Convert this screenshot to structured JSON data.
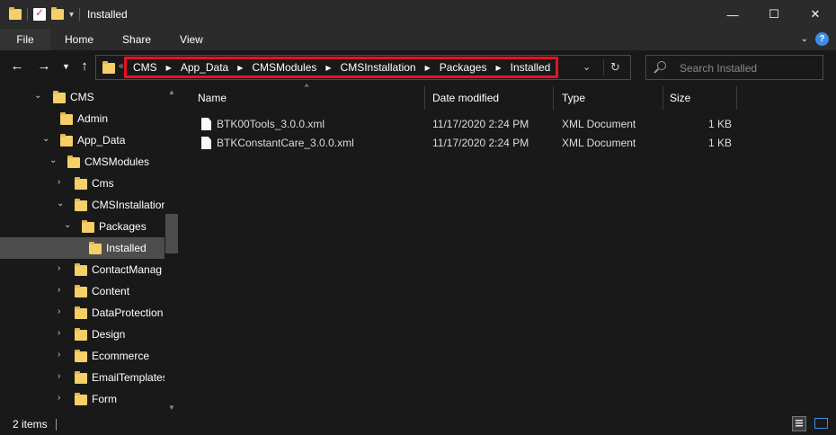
{
  "window": {
    "title": "Installed",
    "controls": {
      "minimize": "—",
      "maximize": "☐",
      "close": "✕"
    }
  },
  "ribbon": {
    "tabs": [
      "File",
      "Home",
      "Share",
      "View"
    ]
  },
  "nav": {
    "back": "←",
    "forward": "→",
    "recent": "⌄",
    "up": "↑",
    "address_overflow": "«",
    "breadcrumbs": [
      "CMS",
      "App_Data",
      "CMSModules",
      "CMSInstallation",
      "Packages",
      "Installed"
    ],
    "breadcrumb_separator": "›",
    "address_dropdown": "⌄",
    "refresh": "↻",
    "search_placeholder": "Search Installed",
    "highlight_color": "#e81123"
  },
  "tree": {
    "items": [
      {
        "label": "CMS",
        "expanded": true
      },
      {
        "label": "Admin",
        "expanded": false
      },
      {
        "label": "App_Data",
        "expanded": true
      },
      {
        "label": "CMSModules",
        "expanded": true
      },
      {
        "label": "Cms",
        "expanded": false
      },
      {
        "label": "CMSInstallatior",
        "expanded": true
      },
      {
        "label": "Packages",
        "expanded": true
      },
      {
        "label": "Installed",
        "selected": true
      },
      {
        "label": "ContactManag",
        "expanded": false
      },
      {
        "label": "Content",
        "expanded": false
      },
      {
        "label": "DataProtection",
        "expanded": false
      },
      {
        "label": "Design",
        "expanded": false
      },
      {
        "label": "Ecommerce",
        "expanded": false
      },
      {
        "label": "EmailTemplates",
        "expanded": false
      },
      {
        "label": "Form",
        "expanded": false
      }
    ],
    "expander_open": "⌄",
    "expander_closed": "›"
  },
  "files": {
    "columns": [
      "Name",
      "Date modified",
      "Type",
      "Size"
    ],
    "sort_indicator": "^",
    "rows": [
      {
        "name": "BTK00Tools_3.0.0.xml",
        "date": "11/17/2020 2:24 PM",
        "type": "XML Document",
        "size": "1 KB"
      },
      {
        "name": "BTKConstantCare_3.0.0.xml",
        "date": "11/17/2020 2:24 PM",
        "type": "XML Document",
        "size": "1 KB"
      }
    ]
  },
  "status": {
    "item_count": "2 items"
  },
  "colors": {
    "background": "#191919",
    "chrome": "#2b2b2b",
    "folder": "#f5cf68",
    "selection": "#4d4d4d",
    "accent": "#3a8ee6"
  }
}
